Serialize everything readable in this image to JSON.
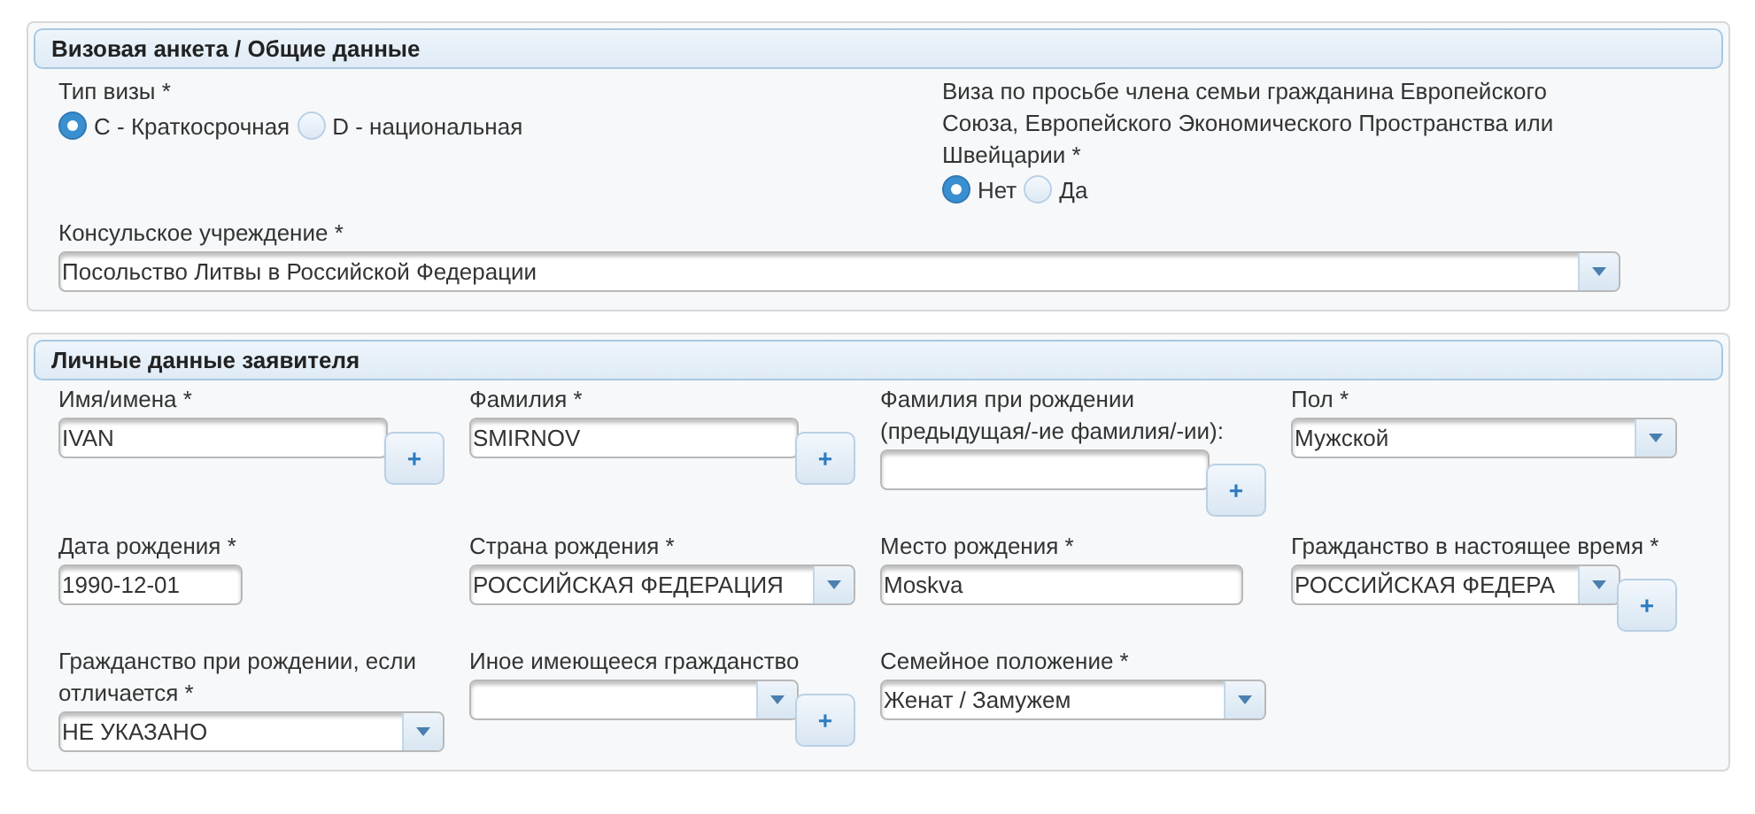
{
  "sections": [
    {
      "title": "Визовая анкета / Общие данные",
      "kind": "general",
      "visa_type": {
        "label": "Тип визы *",
        "options": [
          {
            "label": "C - Краткосрочная",
            "selected": true
          },
          {
            "label": "D - национальная",
            "selected": false
          }
        ]
      },
      "family_visa": {
        "label": "Виза по просьбе члена семьи гражданина Европейского Союза, Европейского Экономического Пространства или Швейцарии *",
        "options": [
          {
            "label": "Нет",
            "selected": true
          },
          {
            "label": "Да",
            "selected": false
          }
        ]
      },
      "consulate": {
        "label": "Консульское учреждение *",
        "value": "Посольство Литвы в Российской Федерации"
      }
    },
    {
      "title": "Личные данные заявителя",
      "kind": "personal",
      "fields": [
        {
          "label": "Имя/имена *",
          "kind": "text",
          "value": "IVAN",
          "add": "+"
        },
        {
          "label": "Фамилия *",
          "kind": "text",
          "value": "SMIRNOV",
          "add": "+"
        },
        {
          "label": "Фамилия при рождении (предыдущая/-ие фамилия/-ии):",
          "kind": "text",
          "add": "+"
        },
        {
          "label": "Пол *",
          "kind": "select",
          "value": "Мужской"
        },
        {
          "label": "Дата рождения *",
          "kind": "date",
          "value": "1990-12-01"
        },
        {
          "label": "Страна рождения *",
          "kind": "select",
          "value": "РОССИЙСКАЯ ФЕДЕРАЦИЯ"
        },
        {
          "label": "Место рождения *",
          "kind": "text",
          "value": "Moskva"
        },
        {
          "label": "Гражданство в настоящее время *",
          "kind": "select",
          "value": "РОССИЙСКАЯ ФЕДЕРА",
          "add": "+"
        },
        {
          "label": "Гражданство при рождении, если отличается *",
          "kind": "select",
          "value": "НЕ УКАЗАНО"
        },
        {
          "label": "Иное имеющееся гражданство",
          "kind": "select",
          "add": "+"
        },
        {
          "label": "Семейное положение *",
          "kind": "select",
          "value": "Женат / Замужем"
        }
      ]
    }
  ]
}
